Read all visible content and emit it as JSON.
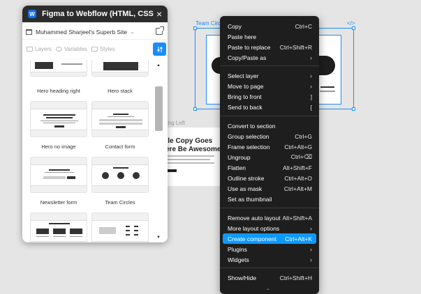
{
  "canvas": {
    "frame_label": "ading Left",
    "frame_heading": "tle Copy Goes\nere Be Awesome",
    "selection_label": "Team Circl",
    "selection_code": "</>"
  },
  "plugin": {
    "title": "Figma to Webflow (HTML, CSS and ...",
    "logo": "W",
    "close": "×",
    "site_name": "Muhammed Sharjeel's Superb Site",
    "site_chevron": "⌄",
    "tabs": [
      "Layers",
      "Variables",
      "Styles"
    ],
    "tab_action_icon": "sliders-icon",
    "templates": [
      {
        "label": "Hero heading right"
      },
      {
        "label": "Hero stack"
      },
      {
        "label": "Hero no image"
      },
      {
        "label": "Contact form"
      },
      {
        "label": "Newsletter form"
      },
      {
        "label": "Team Circles"
      }
    ],
    "scroll_up": "▲",
    "scroll_down": "▼"
  },
  "menu": {
    "items": [
      {
        "label": "Copy",
        "shortcut": "Ctrl+C"
      },
      {
        "label": "Paste here",
        "shortcut": ""
      },
      {
        "label": "Paste to replace",
        "shortcut": "Ctrl+Shift+R"
      },
      {
        "label": "Copy/Paste as",
        "shortcut": "›"
      },
      {
        "label": "Select layer",
        "shortcut": "›"
      },
      {
        "label": "Move to page",
        "shortcut": "›"
      },
      {
        "label": "Bring to front",
        "shortcut": "]"
      },
      {
        "label": "Send to back",
        "shortcut": "["
      },
      {
        "label": "Convert to section",
        "shortcut": ""
      },
      {
        "label": "Group selection",
        "shortcut": "Ctrl+G"
      },
      {
        "label": "Frame selection",
        "shortcut": "Ctrl+Alt+G"
      },
      {
        "label": "Ungroup",
        "shortcut": "Ctrl+⌫"
      },
      {
        "label": "Flatten",
        "shortcut": "Alt+Shift+F"
      },
      {
        "label": "Outline stroke",
        "shortcut": "Ctrl+Alt+O"
      },
      {
        "label": "Use as mask",
        "shortcut": "Ctrl+Alt+M"
      },
      {
        "label": "Set as thumbnail",
        "shortcut": ""
      },
      {
        "label": "Remove auto layout",
        "shortcut": "Alt+Shift+A"
      },
      {
        "label": "More layout options",
        "shortcut": "›"
      },
      {
        "label": "Create component",
        "shortcut": "Ctrl+Alt+K"
      },
      {
        "label": "Plugins",
        "shortcut": "›"
      },
      {
        "label": "Widgets",
        "shortcut": "›"
      },
      {
        "label": "Show/Hide",
        "shortcut": "Ctrl+Shift+H"
      }
    ],
    "more": "⌄",
    "accent": "#0d99ff"
  }
}
